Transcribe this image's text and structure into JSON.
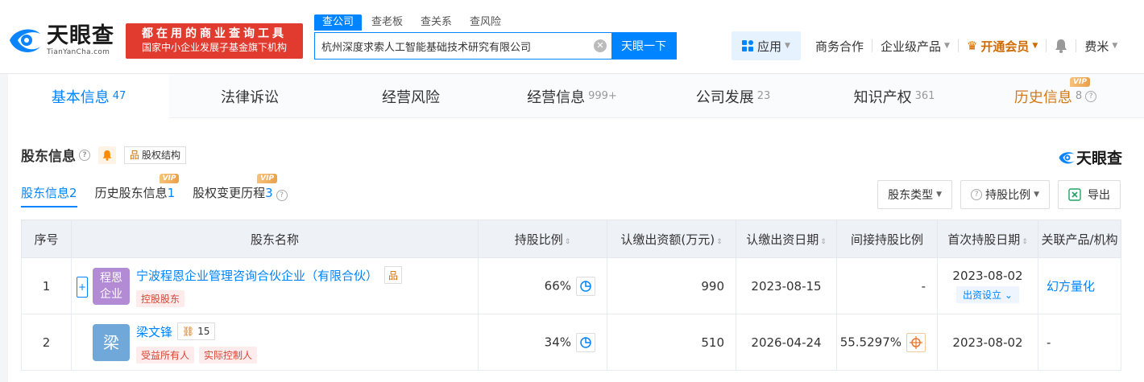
{
  "header": {
    "logo_cn": "天眼查",
    "logo_en": "TianYanCha.com",
    "promo_line1": "都在用的商业查询工具",
    "promo_line2": "国家中小企业发展子基金旗下机构",
    "search_tabs": [
      "查公司",
      "查老板",
      "查关系",
      "查风险"
    ],
    "search_value": "杭州深度求索人工智能基础技术研究有限公司",
    "search_button": "天眼一下",
    "nav": {
      "app": "应用",
      "business": "商务合作",
      "enterprise": "企业级产品",
      "vip": "开通会员",
      "user": "费米"
    }
  },
  "main_tabs": [
    {
      "label": "基本信息",
      "count": "47"
    },
    {
      "label": "法律诉讼",
      "count": ""
    },
    {
      "label": "经营风险",
      "count": ""
    },
    {
      "label": "经营信息",
      "count": "999+"
    },
    {
      "label": "公司发展",
      "count": "23"
    },
    {
      "label": "知识产权",
      "count": "361"
    },
    {
      "label": "历史信息",
      "count": "8"
    }
  ],
  "vip_label": "VIP",
  "section": {
    "title": "股东信息",
    "structure_button": "股权结构",
    "brand": "天眼查"
  },
  "sub_tabs": [
    {
      "label": "股东信息",
      "count": "2"
    },
    {
      "label": "历史股东信息",
      "count": "1"
    },
    {
      "label": "股权变更历程",
      "count": "3"
    }
  ],
  "toolbar": {
    "type": "股东类型",
    "ratio": "持股比例",
    "export": "导出"
  },
  "table": {
    "headers": [
      "序号",
      "股东名称",
      "持股比例",
      "认缴出资额(万元)",
      "认缴出资日期",
      "间接持股比例",
      "首次持股日期",
      "关联产品/机构"
    ],
    "rows": [
      {
        "index": "1",
        "avatar": "程恩企业",
        "avatar_color": "#b28bd4",
        "name": "宁波程恩企业管理咨询合伙企业（有限合伙）",
        "tags": [
          "控股股东"
        ],
        "ratio": "66%",
        "amount": "990",
        "date": "2023-08-15",
        "indirect": "-",
        "first_date": "2023-08-02",
        "first_tag": "出资设立",
        "related": "幻方量化"
      },
      {
        "index": "2",
        "avatar": "梁",
        "avatar_color": "#6fa8d9",
        "name": "梁文锋",
        "link_count": "15",
        "tags": [
          "受益所有人",
          "实际控制人"
        ],
        "ratio": "34%",
        "amount": "510",
        "date": "2026-04-24",
        "indirect": "55.5297%",
        "first_date": "2023-08-02",
        "related": "-"
      }
    ]
  }
}
